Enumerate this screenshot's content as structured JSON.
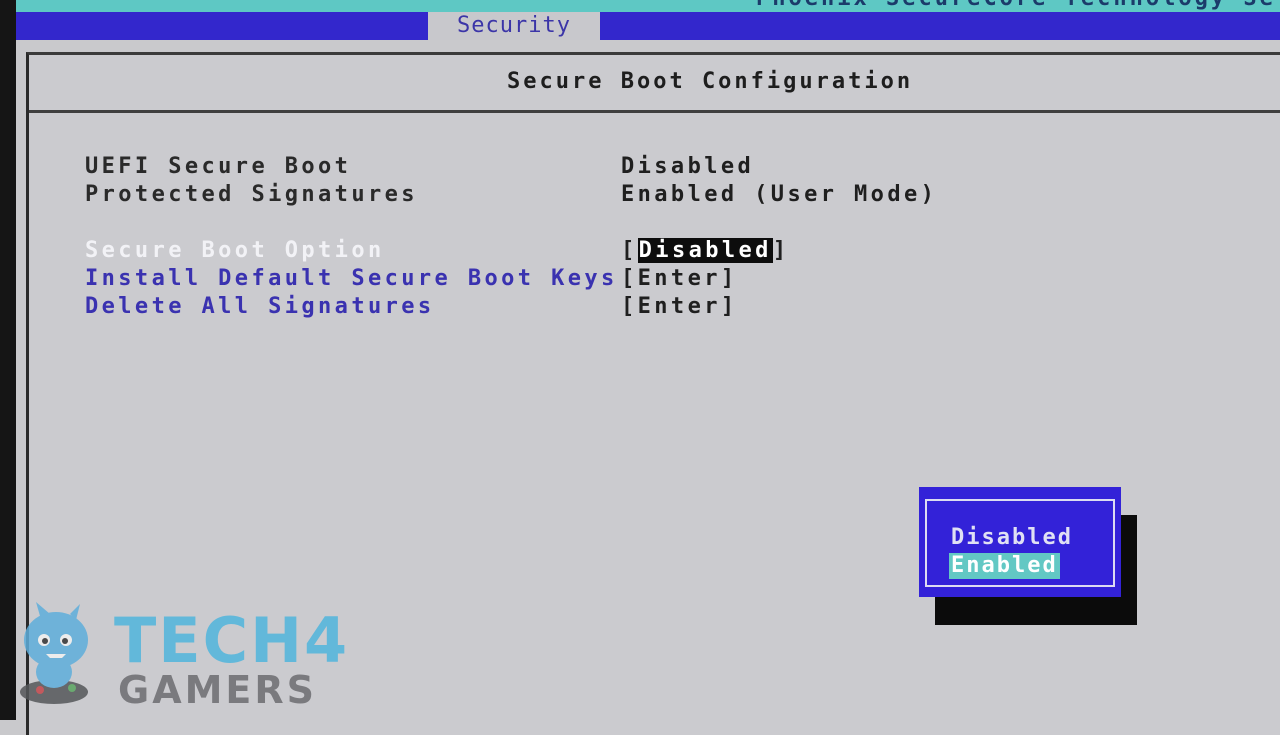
{
  "app": {
    "title": "Phoenix SecureCore Technology Setup"
  },
  "menubar": {
    "active_tab": "Security"
  },
  "panel": {
    "title": "Secure Boot Configuration",
    "info_rows": [
      {
        "label": "UEFI Secure Boot",
        "value": "Disabled"
      },
      {
        "label": "Protected Signatures",
        "value": "Enabled (User Mode)"
      }
    ],
    "option_rows": [
      {
        "label": "Secure Boot Option",
        "value_open": "[",
        "value": "Disabled",
        "value_close": "]",
        "selected": true
      },
      {
        "label": "Install Default Secure Boot Keys",
        "value": "[Enter]"
      },
      {
        "label": "Delete All Signatures",
        "value": "[Enter]"
      }
    ]
  },
  "popup": {
    "options": [
      "Disabled",
      "Enabled"
    ],
    "highlighted": "Enabled"
  },
  "watermark": {
    "line1": "TECH4",
    "line2": "GAMERS",
    "icon": "mascot-icon"
  },
  "colors": {
    "menubar": "#3327cc",
    "topbar": "#5ec8c4",
    "panel_bg": "#cbcbcf",
    "link_text": "#3a32b0",
    "popup_bg": "#3322d8",
    "popup_highlight": "#62c8c4"
  }
}
